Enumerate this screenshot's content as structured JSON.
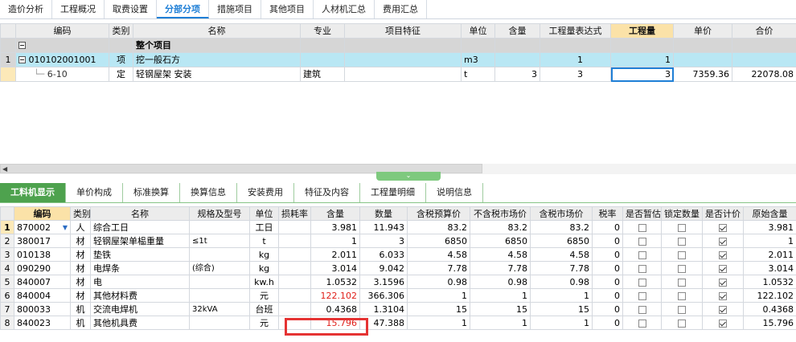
{
  "top_tabs": [
    "造价分析",
    "工程概况",
    "取费设置",
    "分部分项",
    "措施项目",
    "其他项目",
    "人材机汇总",
    "费用汇总"
  ],
  "top_table": {
    "headers": [
      "编码",
      "类别",
      "名称",
      "专业",
      "项目特征",
      "单位",
      "含量",
      "工程量表达式",
      "工程量",
      "单价",
      "合价"
    ],
    "group_row": {
      "name": "整个项目"
    },
    "rows": [
      {
        "num": "1",
        "code": "010102001001",
        "type": "项",
        "name": "挖一般石方",
        "spec": "",
        "feature": "",
        "unit": "m3",
        "content": "",
        "expr": "1",
        "qty": "1",
        "price": "",
        "total": ""
      },
      {
        "num": "",
        "code": "6-10",
        "type": "定",
        "name": "轻钢屋架 安装",
        "spec": "建筑",
        "feature": "",
        "unit": "t",
        "content": "3",
        "expr": "3",
        "qty": "3",
        "price": "7359.36",
        "total": "22078.08"
      }
    ]
  },
  "bottom_tabs": [
    "工料机显示",
    "单价构成",
    "标准换算",
    "换算信息",
    "安装费用",
    "特征及内容",
    "工程量明细",
    "说明信息"
  ],
  "bottom_table": {
    "headers": [
      "编码",
      "类别",
      "名称",
      "规格及型号",
      "单位",
      "损耗率",
      "含量",
      "数量",
      "含税预算价",
      "不含税市场价",
      "含税市场价",
      "税率",
      "是否暂估",
      "锁定数量",
      "是否计价",
      "原始含量"
    ],
    "rows": [
      {
        "num": "1",
        "code": "870002",
        "type": "人",
        "name": "综合工日",
        "spec": "",
        "unit": "工日",
        "loss": "",
        "content": "3.981",
        "qty": "11.943",
        "p1": "83.2",
        "p2": "83.2",
        "p3": "83.2",
        "tax": "0",
        "est": false,
        "lock": false,
        "priced": true,
        "orig": "3.981"
      },
      {
        "num": "2",
        "code": "380017",
        "type": "材",
        "name": "轻钢屋架单榀重量",
        "spec": "≤1t",
        "unit": "t",
        "loss": "",
        "content": "1",
        "qty": "3",
        "p1": "6850",
        "p2": "6850",
        "p3": "6850",
        "tax": "0",
        "est": false,
        "lock": false,
        "priced": true,
        "orig": "1"
      },
      {
        "num": "3",
        "code": "010138",
        "type": "材",
        "name": "垫铁",
        "spec": "",
        "unit": "kg",
        "loss": "",
        "content": "2.011",
        "qty": "6.033",
        "p1": "4.58",
        "p2": "4.58",
        "p3": "4.58",
        "tax": "0",
        "est": false,
        "lock": false,
        "priced": true,
        "orig": "2.011"
      },
      {
        "num": "4",
        "code": "090290",
        "type": "材",
        "name": "电焊条",
        "spec": "(综合)",
        "unit": "kg",
        "loss": "",
        "content": "3.014",
        "qty": "9.042",
        "p1": "7.78",
        "p2": "7.78",
        "p3": "7.78",
        "tax": "0",
        "est": false,
        "lock": false,
        "priced": true,
        "orig": "3.014"
      },
      {
        "num": "5",
        "code": "840007",
        "type": "材",
        "name": "电",
        "spec": "",
        "unit": "kw.h",
        "loss": "",
        "content": "1.0532",
        "qty": "3.1596",
        "p1": "0.98",
        "p2": "0.98",
        "p3": "0.98",
        "tax": "0",
        "est": false,
        "lock": false,
        "priced": true,
        "orig": "1.0532"
      },
      {
        "num": "6",
        "code": "840004",
        "type": "材",
        "name": "其他材料费",
        "spec": "",
        "unit": "元",
        "loss": "",
        "content": "122.102",
        "qty": "366.306",
        "p1": "1",
        "p2": "1",
        "p3": "1",
        "tax": "0",
        "est": false,
        "lock": false,
        "priced": true,
        "orig": "122.102"
      },
      {
        "num": "7",
        "code": "800033",
        "type": "机",
        "name": "交流电焊机",
        "spec": "32kVA",
        "unit": "台班",
        "loss": "",
        "content": "0.4368",
        "qty": "1.3104",
        "p1": "15",
        "p2": "15",
        "p3": "15",
        "tax": "0",
        "est": false,
        "lock": false,
        "priced": true,
        "orig": "0.4368"
      },
      {
        "num": "8",
        "code": "840023",
        "type": "机",
        "name": "其他机具费",
        "spec": "",
        "unit": "元",
        "loss": "",
        "content": "15.796",
        "qty": "47.388",
        "p1": "1",
        "p2": "1",
        "p3": "1",
        "tax": "0",
        "est": false,
        "lock": false,
        "priced": true,
        "orig": "15.796"
      }
    ]
  },
  "colors": {
    "accent": "#1f7fd6",
    "green_tab": "#4ea24e",
    "highlight": "#e53333"
  }
}
